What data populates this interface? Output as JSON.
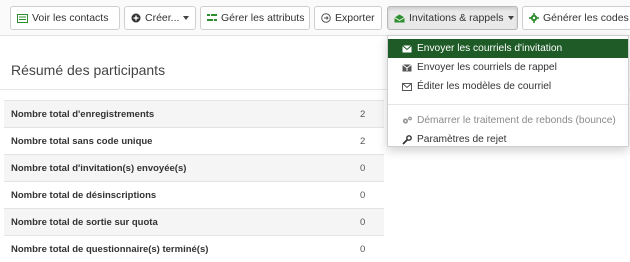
{
  "toolbar": {
    "buttons": [
      {
        "label": "Voir les contacts",
        "icon": "contacts-list-icon"
      },
      {
        "label": "Créer...",
        "icon": "plus-circle-icon"
      },
      {
        "label": "Gérer les attributs",
        "icon": "attributes-icon"
      },
      {
        "label": "Exporter",
        "icon": "export-icon"
      },
      {
        "label": "Invitations & rappels",
        "icon": "envelope-open-icon"
      },
      {
        "label": "Générer les codes d",
        "icon": "gear-icon"
      }
    ]
  },
  "summary": {
    "title": "Résumé des participants",
    "rows": [
      {
        "label": "Nombre total d'enregistrements",
        "value": "2"
      },
      {
        "label": "Nombre total sans code unique",
        "value": "2"
      },
      {
        "label": "Nombre total d'invitation(s) envoyée(s)",
        "value": "0"
      },
      {
        "label": "Nombre total de désinscriptions",
        "value": "0"
      },
      {
        "label": "Nombre total de sortie sur quota",
        "value": "0"
      },
      {
        "label": "Nombre total de questionnaire(s) terminé(s)",
        "value": "0"
      }
    ]
  },
  "dropdown": {
    "items": [
      {
        "label": "Envoyer les courriels d'invitation",
        "icon": "envelope-icon",
        "state": "active"
      },
      {
        "label": "Envoyer les courriels de rappel",
        "icon": "envelope-alert-icon",
        "state": "normal"
      },
      {
        "label": "Éditer les modèles de courriel",
        "icon": "envelope-outline-icon",
        "state": "normal"
      },
      {
        "label": "Démarrer le traitement de rebonds (bounce)",
        "icon": "cogs-icon",
        "state": "disabled"
      },
      {
        "label": "Paramètres de rejet",
        "icon": "wrench-icon",
        "state": "normal"
      }
    ]
  },
  "colors": {
    "accent_green": "#2f8f2f",
    "menu_active_bg": "#1e5b27"
  }
}
